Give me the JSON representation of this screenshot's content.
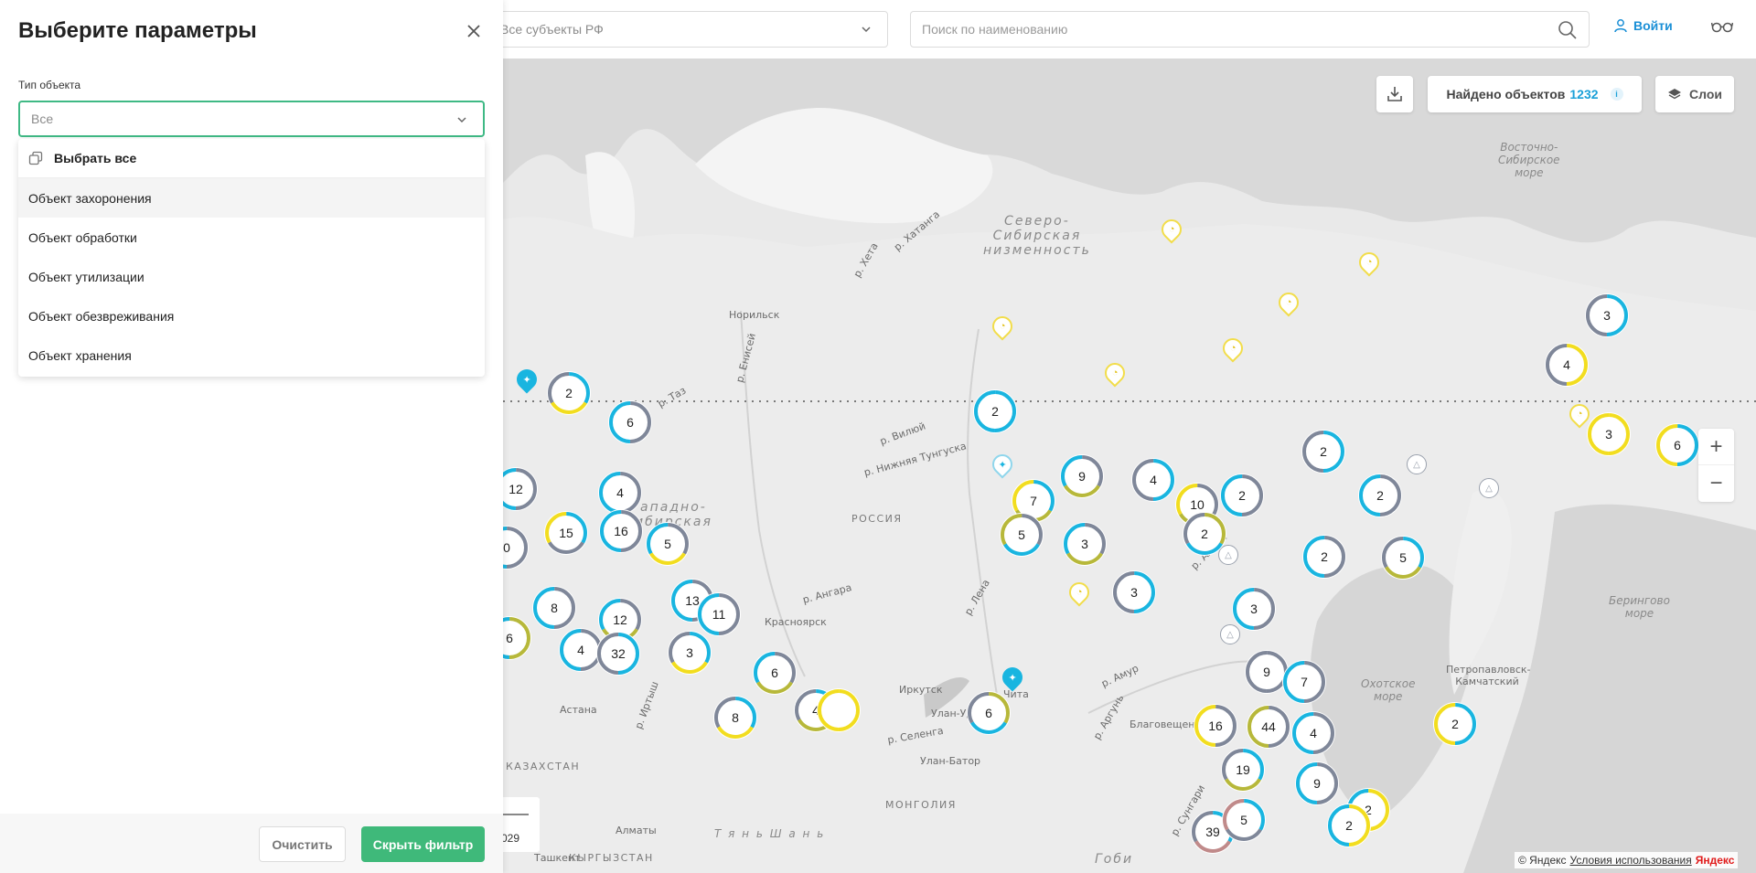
{
  "panel": {
    "title": "Выберите параметры",
    "type_label": "Тип объекта",
    "type_value": "Все",
    "select_all": "Выбрать все",
    "options": [
      "Объект захоронения",
      "Объект обработки",
      "Объект утилизации",
      "Объект обезвреживания",
      "Объект хранения"
    ],
    "clear_label": "Очистить",
    "hide_label": "Скрыть фильтр"
  },
  "topbar": {
    "region_value": "Все субъекты РФ",
    "search_placeholder": "Поиск по наименованию",
    "login_label": "Войти"
  },
  "map": {
    "found_label": "Найдено объектов",
    "found_count": "1232",
    "layers_label": "Слои",
    "scale_text": "029",
    "copyright": "© Яндекс",
    "terms": "Условия использования",
    "brand": "Яндекс",
    "labels": {
      "norilsk": "Норильск",
      "krasnoyarsk": "Красноярск",
      "irkutsk": "Иркутск",
      "chita": "Чита",
      "ulan_ude": "Улан-Удэ",
      "ulan_bator": "Улан-Батор",
      "blagoveshchensk": "Благовещенск",
      "petropavlovsk": "Петропавловск-Камчатский",
      "astana": "Астана",
      "almaty": "Алматы",
      "tashkent": "Ташкент",
      "kazakhstan": "КАЗАХСТАН",
      "kyrgyzstan": "КЫРГЫЗСТАН",
      "mongolia": "МОНГОЛИЯ",
      "russia": "РОССИЯ",
      "west_sib": "ападно-\nибирская",
      "north_sib": "Северо-\nСибирская\nнизменность",
      "east_sib_sea": "Восточно-\nСибирское\nморе",
      "okhotsk": "Охотское\nморе",
      "bering": "Берингово\nморе",
      "gobi": "Гоби",
      "shan": "Т я н ь   Ш а н ь",
      "r_hatanga": "р. Хатанга",
      "r_heta": "р. Хета",
      "r_vilyuy": "р. Вилюй",
      "r_nizh_tunguska": "р. Нижняя Тунгуска",
      "r_angara": "р. Angara",
      "r_lena": "р. Лена",
      "r_amur": "р. Амур",
      "r_selenga": "р. Селенга",
      "r_aldan": "р. Алдан",
      "r_taz": "р. Таз",
      "r_enisey": "р. Енисей",
      "r_irtysh": "р. Иртыш",
      "r_argun": "р. Аргунь",
      "r_sungari": "р. Сунгари"
    }
  },
  "clusters": [
    {
      "n": "2"
    },
    {
      "n": "6"
    },
    {
      "n": "12"
    },
    {
      "n": "4"
    },
    {
      "n": "15"
    },
    {
      "n": "16"
    },
    {
      "n": "5"
    },
    {
      "n": "0"
    },
    {
      "n": "8"
    },
    {
      "n": "12"
    },
    {
      "n": "6"
    },
    {
      "n": "4"
    },
    {
      "n": "32"
    },
    {
      "n": "13"
    },
    {
      "n": "11"
    },
    {
      "n": "3"
    },
    {
      "n": "6"
    },
    {
      "n": "8"
    },
    {
      "n": "4"
    },
    {
      "n": ""
    },
    {
      "n": "6"
    },
    {
      "n": "2"
    },
    {
      "n": "9"
    },
    {
      "n": "7"
    },
    {
      "n": "5"
    },
    {
      "n": "3"
    },
    {
      "n": "4"
    },
    {
      "n": "10"
    },
    {
      "n": "2"
    },
    {
      "n": "2"
    },
    {
      "n": "3"
    },
    {
      "n": "2"
    },
    {
      "n": "2"
    },
    {
      "n": "2"
    },
    {
      "n": "5"
    },
    {
      "n": "3"
    },
    {
      "n": "4"
    },
    {
      "n": "3"
    },
    {
      "n": "6"
    },
    {
      "n": "3"
    },
    {
      "n": "9"
    },
    {
      "n": "7"
    },
    {
      "n": "16"
    },
    {
      "n": "44"
    },
    {
      "n": "4"
    },
    {
      "n": "19"
    },
    {
      "n": "9"
    },
    {
      "n": "2"
    },
    {
      "n": "2"
    },
    {
      "n": "39"
    },
    {
      "n": "5"
    },
    {
      "n": "2"
    }
  ],
  "colors": {
    "accent_green": "#3fb97a",
    "accent_blue": "#1aa0d8",
    "ring_blue": "#19b5e0",
    "ring_yellow": "#f2dd1f",
    "ring_gray": "#7f8799",
    "ring_olive": "#b7b83a"
  }
}
